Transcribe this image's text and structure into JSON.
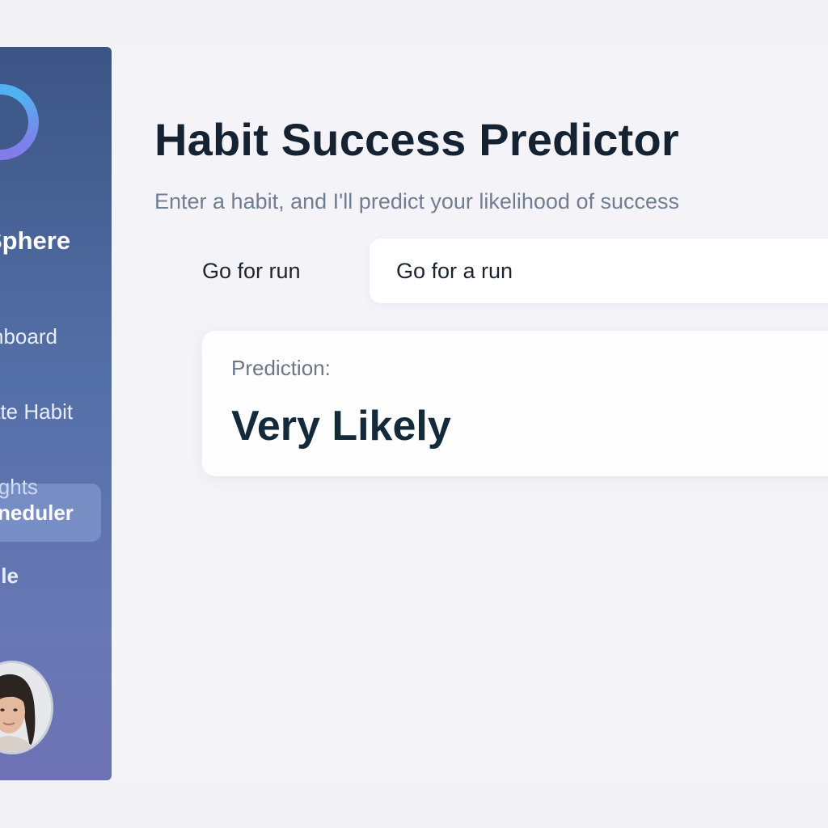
{
  "sidebar": {
    "brand": "Sphere",
    "items": [
      {
        "label": "nboard"
      },
      {
        "label": "ate Habit"
      },
      {
        "label": "ights"
      },
      {
        "label": "neduler"
      },
      {
        "label": "ile"
      }
    ],
    "active_index": 3
  },
  "main": {
    "title": "Habit Success Predictor",
    "subtitle": "Enter a habit, and I'll predict your likelihood of success",
    "field_label": "Go for run",
    "input_value": "Go for a run",
    "result_label": "Prediction:",
    "result_value": "Very Likely"
  },
  "colors": {
    "sidebar_top": "#3c5485",
    "sidebar_bottom": "#6d72b4",
    "title": "#142232",
    "subtitle": "#6f7e93",
    "background": "#f4f4f8"
  }
}
